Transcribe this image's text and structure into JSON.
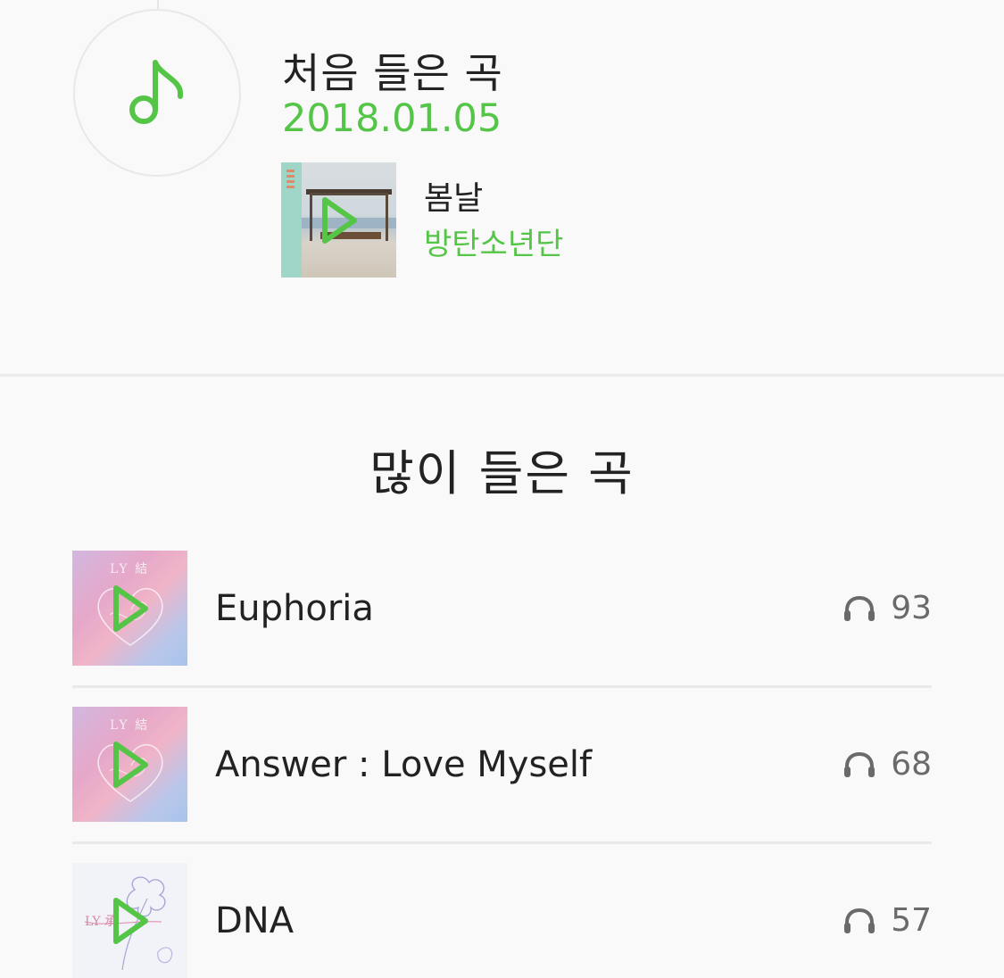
{
  "first_listened": {
    "heading": "처음 들은 곡",
    "date": "2018.01.05",
    "song": {
      "title": "봄날",
      "artist": "방탄소년단"
    }
  },
  "most_listened": {
    "heading": "많이 들은 곡",
    "tracks": [
      {
        "title": "Euphoria",
        "plays": "93",
        "cover": "answer"
      },
      {
        "title": "Answer : Love Myself",
        "plays": "68",
        "cover": "answer"
      },
      {
        "title": "DNA",
        "plays": "57",
        "cover": "dna"
      }
    ]
  },
  "colors": {
    "accent": "#55c548",
    "text": "#222222",
    "muted": "#6a6a6a",
    "divider": "#ebebeb"
  },
  "icons": {
    "note": "music-note-icon",
    "play": "play-icon",
    "headphones": "headphones-icon"
  }
}
